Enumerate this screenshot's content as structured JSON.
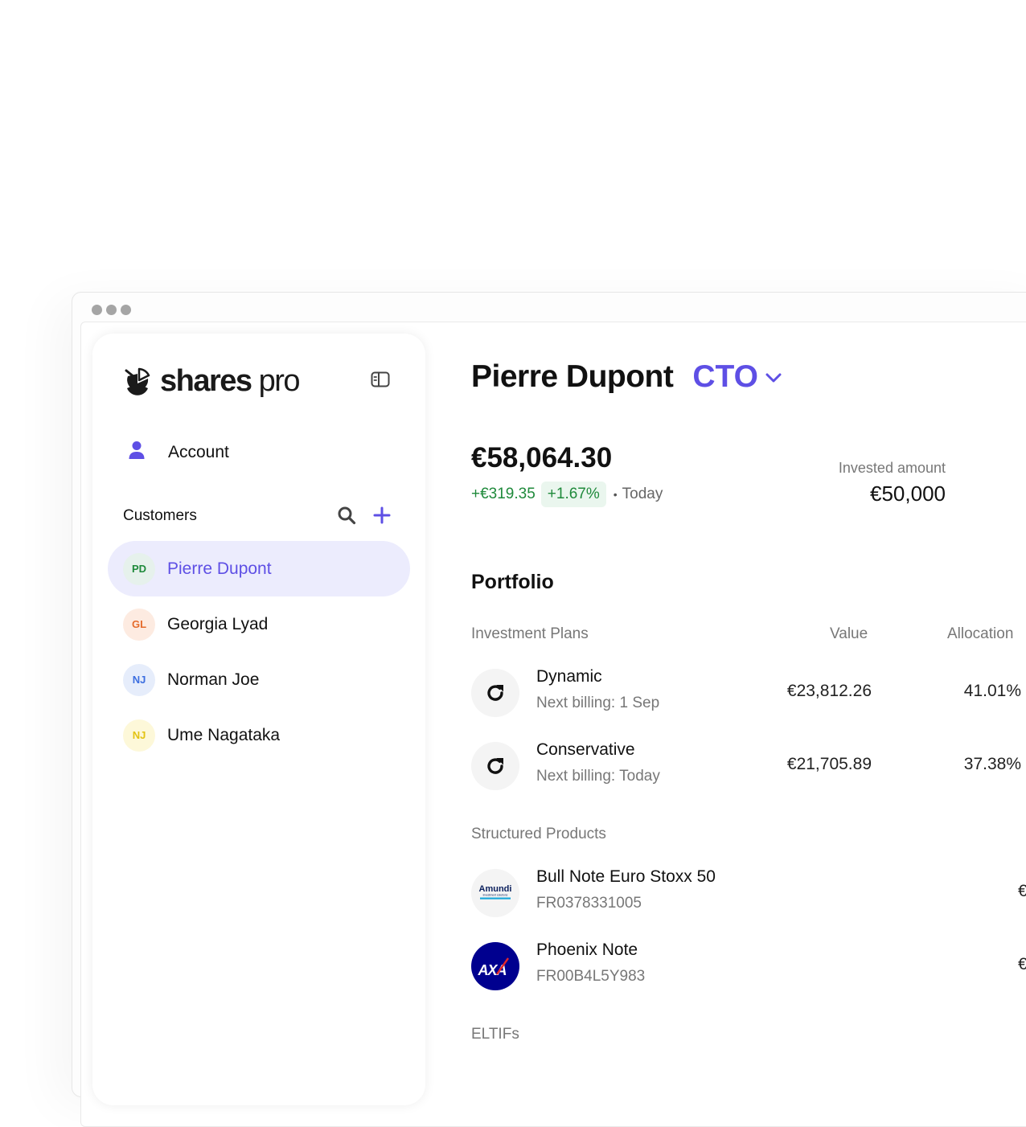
{
  "colors": {
    "accent": "#5e4fe5",
    "positive": "#1f8a3b",
    "positive_bg": "#eaf6ee",
    "active_row_bg": "#ececfd",
    "muted_text": "#777777"
  },
  "sidebar": {
    "logo": {
      "brand_bold": "shares",
      "brand_light": "pro",
      "icon": "pie-chart-logo-icon"
    },
    "collapse_icon": "sidebar-toggle-icon",
    "account": {
      "label": "Account",
      "icon": "user-icon"
    },
    "customers": {
      "title": "Customers",
      "search_icon": "search-icon",
      "add_icon": "plus-icon",
      "items": [
        {
          "initials": "PD",
          "name": "Pierre Dupont",
          "active": true,
          "avatar_bg": "#e6f1ec",
          "avatar_fg": "#1f8a3b"
        },
        {
          "initials": "GL",
          "name": "Georgia Lyad",
          "active": false,
          "avatar_bg": "#fdebe1",
          "avatar_fg": "#e56b2c"
        },
        {
          "initials": "NJ",
          "name": "Norman Joe",
          "active": false,
          "avatar_bg": "#e6edfb",
          "avatar_fg": "#3d6fe0"
        },
        {
          "initials": "NJ",
          "name": "Ume Nagataka",
          "active": false,
          "avatar_bg": "#fdf8d9",
          "avatar_fg": "#e3c313"
        }
      ]
    }
  },
  "main": {
    "client_name": "Pierre Dupont",
    "account_type": "CTO",
    "balance": "€58,064.30",
    "change_abs": "+€319.35",
    "change_pct": "+1.67%",
    "change_sep": "•",
    "change_period": "Today",
    "invested_label": "Invested amount",
    "invested_value": "€50,000",
    "portfolio_title": "Portfolio",
    "columns": {
      "plans": "Investment Plans",
      "value": "Value",
      "allocation": "Allocation"
    },
    "plans": [
      {
        "name": "Dynamic",
        "sub": "Next billing: 1 Sep",
        "value": "€23,812.26",
        "allocation": "41.01%",
        "icon": "refresh-icon"
      },
      {
        "name": "Conservative",
        "sub": "Next billing: Today",
        "value": "€21,705.89",
        "allocation": "37.38%",
        "icon": "refresh-icon"
      }
    ],
    "structured_title": "Structured Products",
    "structured": [
      {
        "name": "Bull Note Euro Stoxx 50",
        "sub": "FR0378331005",
        "value_partial": "€",
        "logo_text": "Amundi",
        "logo_subtext": "investment solutions"
      },
      {
        "name": "Phoenix Note",
        "sub": "FR00B4L5Y983",
        "value_partial": "€",
        "logo_text": "AXA"
      }
    ],
    "eltifs_title": "ELTIFs"
  }
}
